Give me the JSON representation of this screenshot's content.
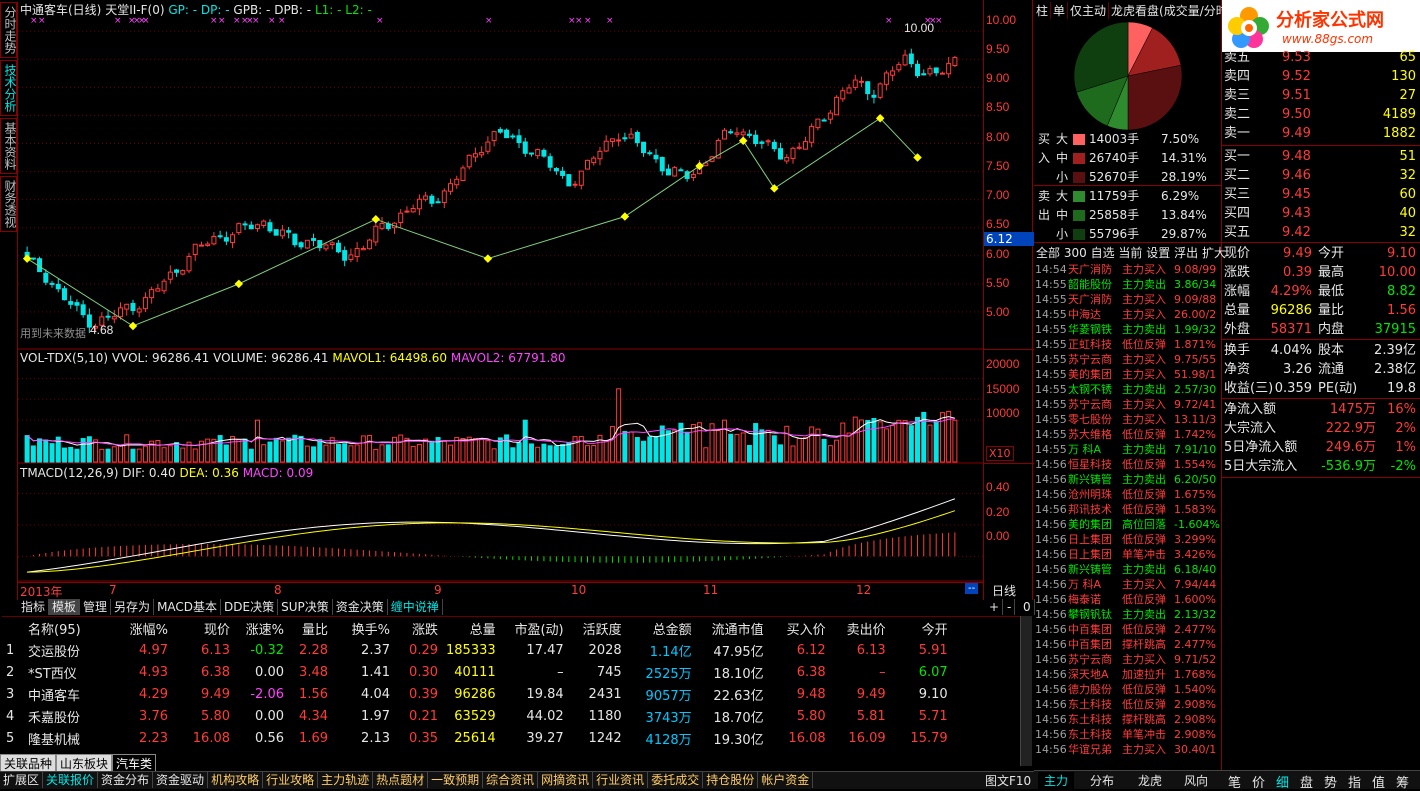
{
  "window": {
    "title": "中通客车(日线)",
    "indicator_title": "天堂II-F(0)",
    "header_items": [
      "GP: -",
      "DP: -",
      "GPB: -",
      "DPB: -",
      "L1: -",
      "L2: -"
    ]
  },
  "side_tabs": [
    "分时走势",
    "技术分析",
    "基本资料",
    "财务透视"
  ],
  "kline": {
    "price_ticks": [
      "10.00",
      "9.50",
      "9.00",
      "8.50",
      "8.00",
      "7.50",
      "7.00",
      "6.50",
      "6.00",
      "5.50",
      "5.00"
    ],
    "current_price_tag": "6.12",
    "high_label": "10.00",
    "low_label": "4.68",
    "note": "用到未来数据",
    "ylim": [
      4.5,
      10.2
    ]
  },
  "volume": {
    "title": "VOL-TDX(5,10)",
    "vvol": "VVOL: 96286.41",
    "volume": "VOLUME: 96286.41",
    "mavol1": "MAVOL1: 64498.60",
    "mavol2": "MAVOL2: 67791.80",
    "ticks": [
      "20000",
      "15000",
      "10000"
    ],
    "unit": "X10"
  },
  "macd": {
    "title": "TMACD(12,26,9)",
    "dif": "DIF: 0.40",
    "dea": "DEA: 0.36",
    "macd": "MACD: 0.09",
    "ticks": [
      "0.40",
      "0.20",
      "0.00"
    ]
  },
  "date_axis": {
    "labels": [
      "2013年",
      "7",
      "8",
      "9",
      "10",
      "11",
      "12"
    ],
    "period": "日线"
  },
  "chart_tabs": [
    "指标",
    "模板",
    "管理",
    "另存为",
    "MACD基本",
    "DDE决策",
    "SUP决策",
    "资金决策",
    "缠中说禅"
  ],
  "chart_tab_controls": [
    "+",
    "-",
    "0"
  ],
  "chart_data": {
    "type": "candlestick",
    "title": "中通客车(日线)",
    "ylim": [
      4.5,
      10.2
    ],
    "x_periods": [
      "2013-06",
      "2013-07",
      "2013-08",
      "2013-09",
      "2013-10",
      "2013-11",
      "2013-12"
    ],
    "approx_close_series": [
      5.9,
      5.7,
      5.3,
      5.0,
      4.8,
      4.9,
      5.1,
      5.2,
      5.5,
      5.8,
      6.1,
      6.3,
      6.4,
      6.5,
      6.6,
      6.4,
      6.2,
      6.3,
      6.1,
      6.0,
      6.2,
      6.5,
      6.7,
      6.9,
      7.0,
      7.2,
      7.6,
      8.0,
      8.2,
      8.0,
      7.9,
      7.6,
      7.3,
      7.5,
      7.9,
      8.2,
      8.0,
      7.8,
      7.5,
      7.4,
      7.6,
      8.0,
      8.3,
      8.1,
      7.9,
      7.8,
      8.0,
      8.4,
      8.8,
      9.1,
      8.9,
      9.2,
      9.5,
      9.3,
      9.2,
      9.49
    ],
    "volume_ylim": [
      0,
      22000
    ],
    "macd_ylim": [
      -0.1,
      0.5
    ]
  },
  "table": {
    "headers": [
      "",
      "名称(95)",
      "涨幅%",
      "现价",
      "涨速%",
      "量比",
      "换手%",
      "涨跌",
      "总量",
      "市盈(动)",
      "活跃度",
      "总金额",
      "流通市值",
      "买入价",
      "卖出价",
      "今开"
    ],
    "rows": [
      [
        "1",
        "交运股份",
        "4.97",
        "6.13",
        "-0.32",
        "2.28",
        "2.37",
        "0.29",
        "185333",
        "17.47",
        "2028",
        "1.14亿",
        "47.95亿",
        "6.12",
        "6.13",
        "5.91"
      ],
      [
        "2",
        "*ST西仪",
        "4.93",
        "6.38",
        "0.00",
        "3.48",
        "1.41",
        "0.30",
        "40111",
        "–",
        "745",
        "2525万",
        "18.10亿",
        "6.38",
        "–",
        "6.07"
      ],
      [
        "3",
        "中通客车",
        "4.29",
        "9.49",
        "-2.06",
        "1.56",
        "4.04",
        "0.39",
        "96286",
        "19.84",
        "2431",
        "9057万",
        "22.63亿",
        "9.48",
        "9.49",
        "9.10"
      ],
      [
        "4",
        "禾嘉股份",
        "3.76",
        "5.80",
        "0.00",
        "4.34",
        "1.97",
        "0.21",
        "63529",
        "44.02",
        "1180",
        "3743万",
        "18.70亿",
        "5.80",
        "5.81",
        "5.71"
      ],
      [
        "5",
        "隆基机械",
        "2.23",
        "16.08",
        "0.56",
        "1.69",
        "2.13",
        "0.35",
        "25614",
        "39.27",
        "1242",
        "4128万",
        "19.30亿",
        "16.08",
        "16.09",
        "15.79"
      ]
    ]
  },
  "sheet_tabs": [
    "关联品种",
    "山东板块",
    "汽车类"
  ],
  "bottom_tabs": [
    "扩展区",
    "关联报价",
    "资金分布",
    "资金驱动",
    "机构攻略",
    "行业攻略",
    "主力轨迹",
    "热点题材",
    "一致预期",
    "综合资讯",
    "网摘资讯",
    "行业资讯",
    "委托成交",
    "持仓股份",
    "帐户资金"
  ],
  "bottom_right": "图文F10",
  "mid_panel": {
    "tabs": [
      "柱",
      "单",
      "仅主动",
      "龙虎看盘(成交量/分时)"
    ],
    "pie_colors": [
      "#ff6060",
      "#a02020",
      "#5a1010",
      "#2e8b2e",
      "#1e6b1e",
      "#0f3f0f"
    ],
    "buy_label": "买入",
    "sell_label": "卖出",
    "flows": [
      {
        "size": "大",
        "vol": "14003手",
        "pct": "7.50%",
        "color": "#ff6060"
      },
      {
        "size": "中",
        "vol": "26740手",
        "pct": "14.31%",
        "color": "#a02020"
      },
      {
        "size": "小",
        "vol": "52670手",
        "pct": "28.19%",
        "color": "#5a1010"
      },
      {
        "size": "大",
        "vol": "11759手",
        "pct": "6.29%",
        "color": "#2e8b2e"
      },
      {
        "size": "中",
        "vol": "25858手",
        "pct": "13.84%",
        "color": "#1e6b1e"
      },
      {
        "size": "小",
        "vol": "55796手",
        "pct": "29.87%",
        "color": "#0f3f0f"
      }
    ],
    "filters": [
      "全部",
      "300",
      "自选",
      "当前",
      "设置",
      "浮出",
      "扩大"
    ],
    "ticks": [
      [
        "14:54",
        "天广消防",
        "主力买入",
        "9.08/99",
        "r"
      ],
      [
        "14:55",
        "韶能股份",
        "主力卖出",
        "3.86/34",
        "g"
      ],
      [
        "14:55",
        "天广消防",
        "主力买入",
        "9.09/88",
        "r"
      ],
      [
        "14:55",
        "中海达",
        "主力买入",
        "26.00/2",
        "r"
      ],
      [
        "14:55",
        "华菱钢铁",
        "主力卖出",
        "1.99/32",
        "g"
      ],
      [
        "14:55",
        "正虹科技",
        "低位反弹",
        "1.871%",
        "r"
      ],
      [
        "14:55",
        "苏宁云商",
        "主力买入",
        "9.75/55",
        "r"
      ],
      [
        "14:55",
        "美的集团",
        "主力买入",
        "51.98/1",
        "r"
      ],
      [
        "14:55",
        "太钢不锈",
        "主力卖出",
        "2.57/30",
        "g"
      ],
      [
        "14:55",
        "苏宁云商",
        "主力买入",
        "9.72/41",
        "r"
      ],
      [
        "14:55",
        "零七股份",
        "主力买入",
        "13.11/3",
        "r"
      ],
      [
        "14:55",
        "苏大维格",
        "低位反弹",
        "1.742%",
        "r"
      ],
      [
        "14:55",
        "万 科A",
        "主力卖出",
        "7.91/10",
        "g"
      ],
      [
        "14:56",
        "恒星科技",
        "低位反弹",
        "1.554%",
        "r"
      ],
      [
        "14:56",
        "新兴铸管",
        "主力卖出",
        "6.20/50",
        "g"
      ],
      [
        "14:56",
        "沧州明珠",
        "低位反弹",
        "1.675%",
        "r"
      ],
      [
        "14:56",
        "邦讯技术",
        "低位反弹",
        "1.583%",
        "r"
      ],
      [
        "14:56",
        "美的集团",
        "高位回落",
        "-1.604%",
        "g"
      ],
      [
        "14:56",
        "日上集团",
        "低位反弹",
        "3.299%",
        "r"
      ],
      [
        "14:56",
        "日上集团",
        "单笔冲击",
        "3.426%",
        "r"
      ],
      [
        "14:56",
        "新兴铸管",
        "主力卖出",
        "6.18/40",
        "g"
      ],
      [
        "14:56",
        "万 科A",
        "主力买入",
        "7.94/44",
        "r"
      ],
      [
        "14:56",
        "梅泰诺",
        "低位反弹",
        "1.600%",
        "r"
      ],
      [
        "14:56",
        "攀钢钒钛",
        "主力卖出",
        "2.13/32",
        "g"
      ],
      [
        "14:56",
        "中百集团",
        "低位反弹",
        "2.477%",
        "r"
      ],
      [
        "14:56",
        "中百集团",
        "撑杆跳高",
        "2.477%",
        "r"
      ],
      [
        "14:56",
        "苏宁云商",
        "主力买入",
        "9.71/52",
        "r"
      ],
      [
        "14:56",
        "深天地A",
        "加速拉升",
        "1.768%",
        "r"
      ],
      [
        "14:56",
        "德力股份",
        "低位反弹",
        "1.540%",
        "r"
      ],
      [
        "14:56",
        "东土科技",
        "低位反弹",
        "2.908%",
        "r"
      ],
      [
        "14:56",
        "东土科技",
        "撑杆跳高",
        "2.908%",
        "r"
      ],
      [
        "14:56",
        "东土科技",
        "单笔冲击",
        "2.908%",
        "r"
      ],
      [
        "14:56",
        "华谊兄弟",
        "主力买入",
        "30.40/1",
        "r"
      ]
    ],
    "bottom_tabs": [
      "主力",
      "分布",
      "龙虎",
      "风向"
    ]
  },
  "right_panel": {
    "logo": "分析家公式网",
    "logo_url": "www.88gs.com",
    "asks": [
      [
        "卖五",
        "9.53",
        "65"
      ],
      [
        "卖四",
        "9.52",
        "130"
      ],
      [
        "卖三",
        "9.51",
        "27"
      ],
      [
        "卖二",
        "9.50",
        "4189"
      ],
      [
        "卖一",
        "9.49",
        "1882"
      ]
    ],
    "bids": [
      [
        "买一",
        "9.48",
        "51"
      ],
      [
        "买二",
        "9.46",
        "32"
      ],
      [
        "买三",
        "9.45",
        "60"
      ],
      [
        "买四",
        "9.43",
        "40"
      ],
      [
        "买五",
        "9.42",
        "32"
      ]
    ],
    "quote": [
      [
        "现价",
        "9.49",
        "今开",
        "9.10"
      ],
      [
        "涨跌",
        "0.39",
        "最高",
        "10.00"
      ],
      [
        "涨幅",
        "4.29%",
        "最低",
        "8.82"
      ],
      [
        "总量",
        "96286",
        "量比",
        "1.56"
      ],
      [
        "外盘",
        "58371",
        "内盘",
        "37915"
      ]
    ],
    "fund": [
      [
        "换手",
        "4.04%",
        "股本",
        "2.39亿"
      ],
      [
        "净资",
        "3.26",
        "流通",
        "2.38亿"
      ],
      [
        "收益(三)",
        "0.359",
        "PE(动)",
        "19.8"
      ]
    ],
    "flow": [
      [
        "净流入额",
        "1475万",
        "16%"
      ],
      [
        "大宗流入",
        "222.9万",
        "2%"
      ],
      [
        "5日净流入额",
        "249.6万",
        "1%"
      ],
      [
        "5日大宗流入",
        "-536.9万",
        "-2%"
      ]
    ],
    "bottom_tabs": [
      "笔",
      "价",
      "细",
      "盘",
      "势",
      "指",
      "值",
      "筹"
    ]
  }
}
